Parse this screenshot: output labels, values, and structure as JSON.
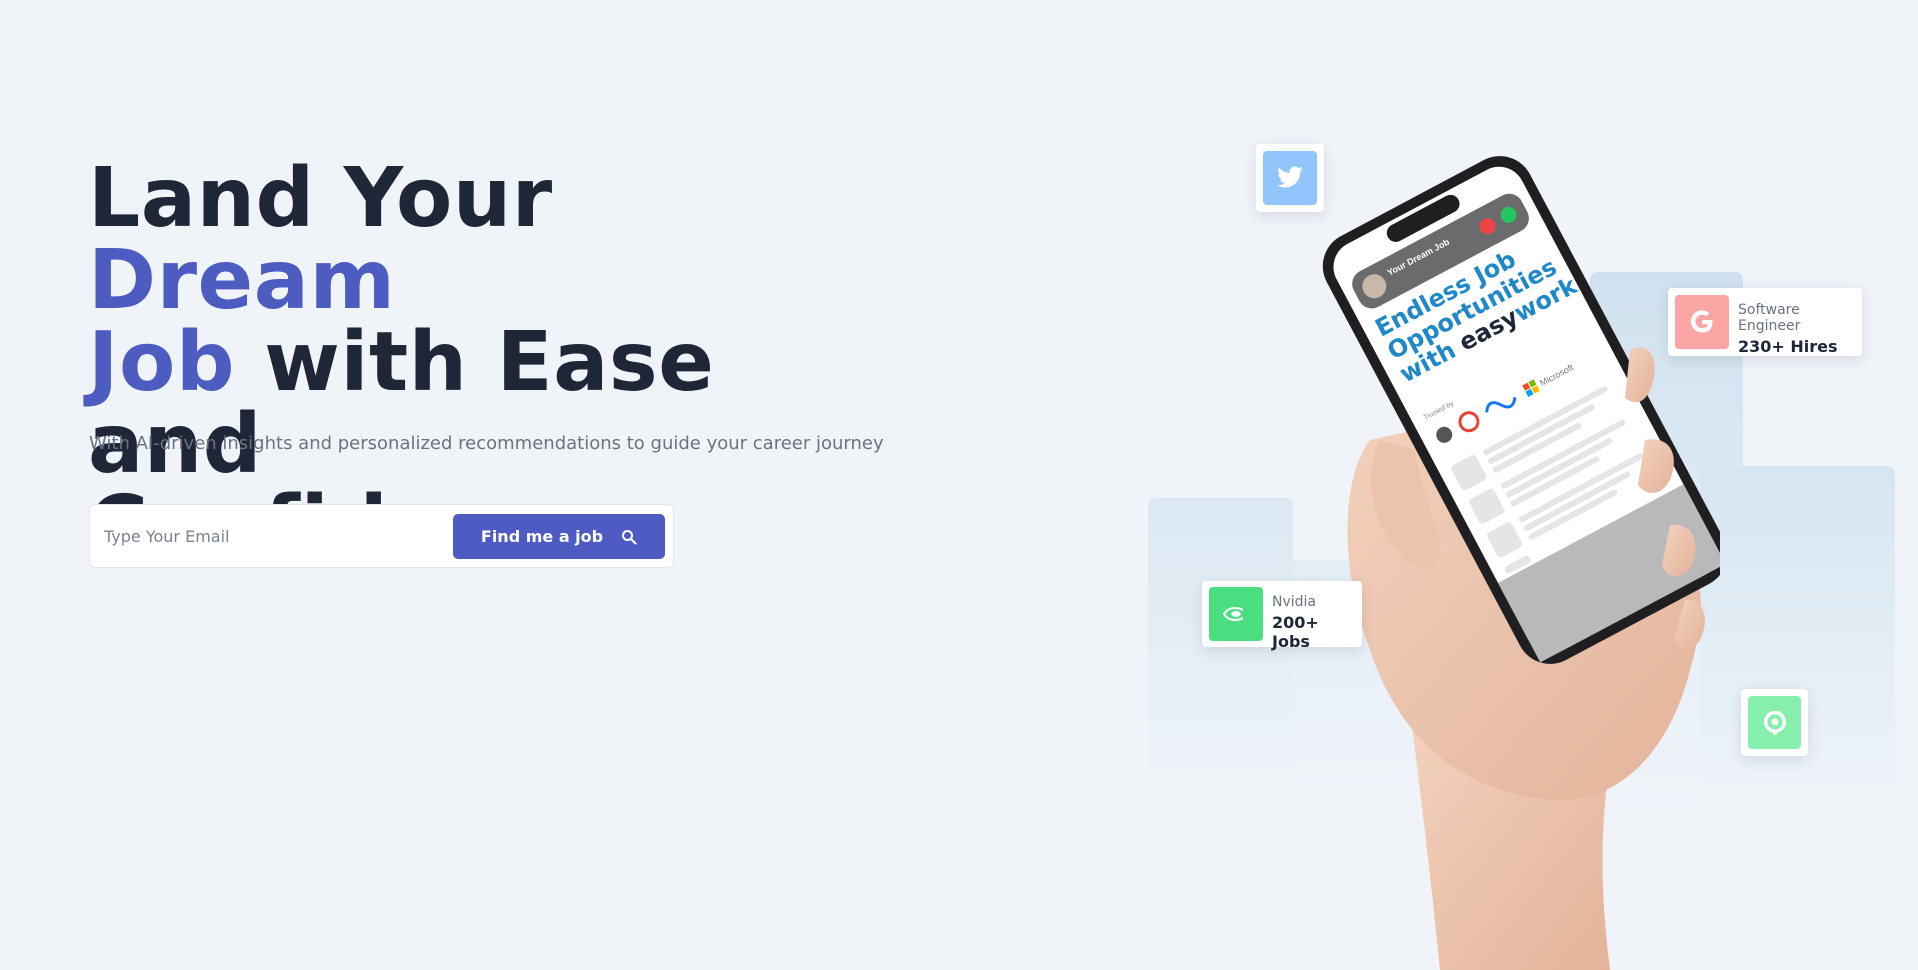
{
  "hero": {
    "headline_part1": "Land Your ",
    "headline_accent1": "Dream",
    "headline_accent2": "Job",
    "headline_part2": " with Ease and",
    "headline_part3": "Confidence",
    "subtitle": "With AI-driven insights and personalized recommendations to guide your career journey",
    "email_placeholder": "Type Your Email",
    "cta_label": "Find me a job"
  },
  "floating_cards": {
    "twitter": {
      "icon": "twitter-icon"
    },
    "google": {
      "icon": "google-icon",
      "subtitle": "Software Engineer",
      "value": "230+ Hires"
    },
    "nvidia": {
      "icon": "nvidia-icon",
      "subtitle": "Nvidia",
      "value": "200+ Jobs"
    },
    "pin": {
      "icon": "location-pin-icon"
    }
  },
  "phone_screen": {
    "caller": "Your Dream Job",
    "headline_line1": "Endless Job",
    "headline_line2": "Opportunities",
    "headline_line3_prefix": "with ",
    "headline_brand_easy": "easy",
    "headline_brand_work": "work",
    "trusted_by": "Trusted by",
    "microsoft": "Microsoft"
  },
  "colors": {
    "accent": "#4d5cc1",
    "background": "#f0f4f9",
    "text": "#1e2638"
  }
}
